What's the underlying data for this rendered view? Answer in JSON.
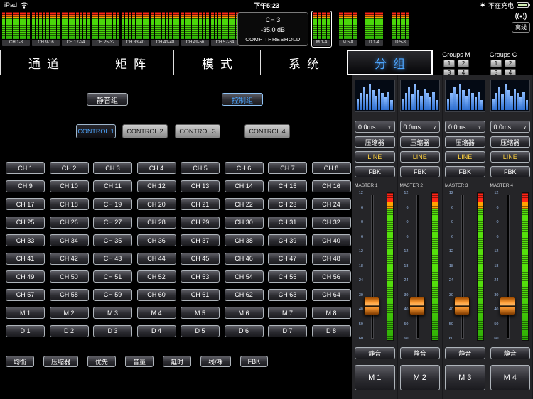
{
  "status_bar": {
    "device": "iPad",
    "time": "下午5:23",
    "charge_prefix": "✱",
    "charge_note": "不在充电"
  },
  "meter_bridge": {
    "channel_groups": [
      "CH 1-8",
      "CH 9-16",
      "CH 17-24",
      "CH 25-32",
      "CH 33-40",
      "CH 41-48",
      "CH 49-56",
      "CH 57-64"
    ],
    "master_groups": [
      "M 1-4",
      "M 5-8",
      "D 1-4",
      "D 5-8"
    ],
    "selected_master_group": "M 1-4",
    "info": {
      "channel": "CH 3",
      "value": "-35.0 dB",
      "param": "COMP THRESHOLD"
    },
    "offline_label": "离线"
  },
  "nav": {
    "tabs": [
      {
        "label": "通道",
        "active": false
      },
      {
        "label": "矩阵",
        "active": false
      },
      {
        "label": "模式",
        "active": false
      },
      {
        "label": "系统",
        "active": false
      },
      {
        "label": "分组",
        "active": true
      }
    ],
    "groups_m": {
      "label": "Groups M",
      "buttons": [
        "1",
        "2",
        "3",
        "4"
      ]
    },
    "groups_c": {
      "label": "Groups C",
      "buttons": [
        "1",
        "2",
        "3",
        "4"
      ]
    }
  },
  "main": {
    "mute_group": "静音组",
    "control_group": "控制组",
    "control_tabs": [
      "CONTROL 1",
      "CONTROL 2",
      "CONTROL 3",
      "CONTROL 4"
    ],
    "active_control_tab": "CONTROL 1",
    "channel_buttons": [
      "CH 1",
      "CH 2",
      "CH 3",
      "CH 4",
      "CH 5",
      "CH 6",
      "CH 7",
      "CH 8",
      "CH 9",
      "CH 10",
      "CH 11",
      "CH 12",
      "CH 13",
      "CH 14",
      "CH 15",
      "CH 16",
      "CH 17",
      "CH 18",
      "CH 19",
      "CH 20",
      "CH 21",
      "CH 22",
      "CH 23",
      "CH 24",
      "CH 25",
      "CH 26",
      "CH 27",
      "CH 28",
      "CH 29",
      "CH 30",
      "CH 31",
      "CH 32",
      "CH 33",
      "CH 34",
      "CH 35",
      "CH 36",
      "CH 37",
      "CH 38",
      "CH 39",
      "CH 40",
      "CH 41",
      "CH 42",
      "CH 43",
      "CH 44",
      "CH 45",
      "CH 46",
      "CH 47",
      "CH 48",
      "CH 49",
      "CH 50",
      "CH 51",
      "CH 52",
      "CH 53",
      "CH 54",
      "CH 55",
      "CH 56",
      "CH 57",
      "CH 58",
      "CH 59",
      "CH 60",
      "CH 61",
      "CH 62",
      "CH 63",
      "CH 64"
    ],
    "m_buttons": [
      "M 1",
      "M 2",
      "M 3",
      "M 4",
      "M 5",
      "M 6",
      "M 7",
      "M 8"
    ],
    "d_buttons": [
      "D 1",
      "D 2",
      "D 3",
      "D 4",
      "D 5",
      "D 6",
      "D 7",
      "D 8"
    ],
    "function_buttons": [
      "均衡",
      "压缩器",
      "优先",
      "音量",
      "延时",
      "线/咪",
      "FBK"
    ]
  },
  "masters": {
    "common": {
      "comp": "压缩器",
      "line": "LINE",
      "fbk": "FBK",
      "mute": "静音"
    },
    "scale": [
      "12",
      "6",
      "0",
      "6",
      "12",
      "18",
      "24",
      "30",
      "40",
      "50",
      "60"
    ],
    "strips": [
      {
        "title": "MASTER 1",
        "delay": "0.0ms",
        "name": "M 1"
      },
      {
        "title": "MASTER 2",
        "delay": "0.0ms",
        "name": "M 2"
      },
      {
        "title": "MASTER 3",
        "delay": "0.0ms",
        "name": "M 3"
      },
      {
        "title": "MASTER 4",
        "delay": "0.0ms",
        "name": "M 4"
      }
    ]
  },
  "icons": {
    "chevron_down": "∨"
  },
  "colors": {
    "accent_blue": "#4da6ff",
    "line_yellow": "#ffd23f",
    "fader_orange": "#ff8c1a",
    "meter_green": "#3ae10a",
    "meter_red": "#ff2d1e"
  }
}
